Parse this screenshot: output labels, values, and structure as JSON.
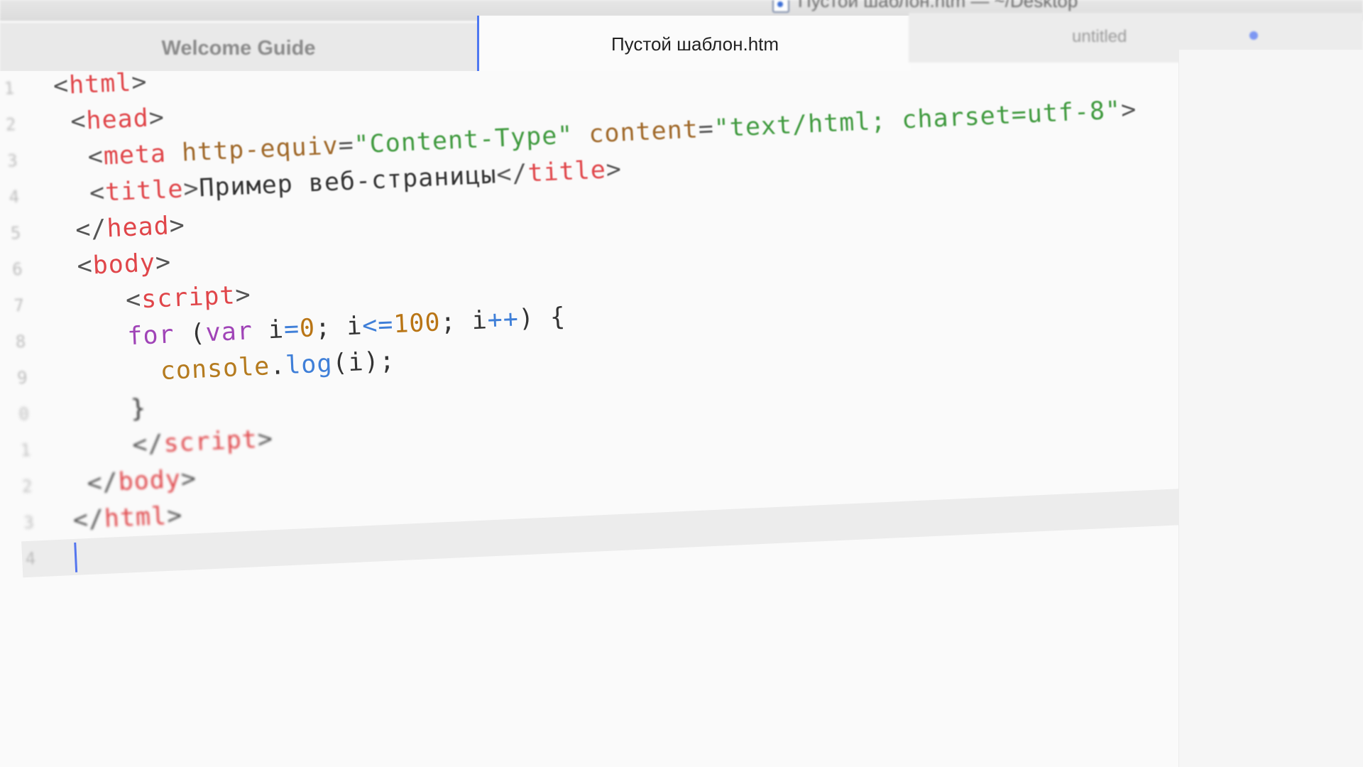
{
  "window": {
    "title": "Пустой шаблон.htm — ~/Desktop",
    "title_visible": "Пустой шаблон.htm — ~/Desktop"
  },
  "tabs": [
    {
      "label": "Welcome Guide",
      "active": false
    },
    {
      "label": "Пустой шаблон.htm",
      "active": true
    },
    {
      "label": "untitled",
      "active": false,
      "modified": true
    }
  ],
  "editor": {
    "line_numbers": [
      "1",
      "2",
      "3",
      "4",
      "5",
      "6",
      "7",
      "8",
      "9",
      "0",
      "1",
      "2",
      "3",
      "4"
    ],
    "cursor_line": 14,
    "lines": [
      [
        {
          "t": "<",
          "c": "pun"
        },
        {
          "t": "html",
          "c": "tag"
        },
        {
          "t": ">",
          "c": "pun"
        }
      ],
      [
        {
          "t": " <",
          "c": "pun"
        },
        {
          "t": "head",
          "c": "tag"
        },
        {
          "t": ">",
          "c": "pun"
        }
      ],
      [
        {
          "t": "  <",
          "c": "pun"
        },
        {
          "t": "meta",
          "c": "tag"
        },
        {
          "t": " http-equiv",
          "c": "attr"
        },
        {
          "t": "=",
          "c": "pun"
        },
        {
          "t": "\"Content-Type\"",
          "c": "str"
        },
        {
          "t": " content",
          "c": "attr"
        },
        {
          "t": "=",
          "c": "pun"
        },
        {
          "t": "\"text/html; charset=utf-8\"",
          "c": "str"
        },
        {
          "t": ">",
          "c": "pun"
        }
      ],
      [
        {
          "t": "  <",
          "c": "pun"
        },
        {
          "t": "title",
          "c": "tag"
        },
        {
          "t": ">",
          "c": "pun"
        },
        {
          "t": "Пример веб-страницы",
          "c": "plain"
        },
        {
          "t": "</",
          "c": "pun"
        },
        {
          "t": "title",
          "c": "tag"
        },
        {
          "t": ">",
          "c": "pun"
        }
      ],
      [
        {
          "t": " </",
          "c": "pun"
        },
        {
          "t": "head",
          "c": "tag"
        },
        {
          "t": ">",
          "c": "pun"
        }
      ],
      [
        {
          "t": " <",
          "c": "pun"
        },
        {
          "t": "body",
          "c": "tag"
        },
        {
          "t": ">",
          "c": "pun"
        }
      ],
      [
        {
          "t": "    <",
          "c": "pun"
        },
        {
          "t": "script",
          "c": "tag"
        },
        {
          "t": ">",
          "c": "pun"
        }
      ],
      [
        {
          "t": "    for",
          "c": "kw"
        },
        {
          "t": " (",
          "c": "plain"
        },
        {
          "t": "var",
          "c": "kw"
        },
        {
          "t": " i",
          "c": "plain"
        },
        {
          "t": "=",
          "c": "fn"
        },
        {
          "t": "0",
          "c": "num"
        },
        {
          "t": "; i",
          "c": "plain"
        },
        {
          "t": "<=",
          "c": "fn"
        },
        {
          "t": "100",
          "c": "num"
        },
        {
          "t": "; i",
          "c": "plain"
        },
        {
          "t": "++",
          "c": "fn"
        },
        {
          "t": ") {",
          "c": "plain"
        }
      ],
      [
        {
          "t": "      console",
          "c": "obj"
        },
        {
          "t": ".",
          "c": "plain"
        },
        {
          "t": "log",
          "c": "fn"
        },
        {
          "t": "(i);",
          "c": "plain"
        }
      ],
      [
        {
          "t": "    }",
          "c": "plain"
        }
      ],
      [
        {
          "t": "    </",
          "c": "pun"
        },
        {
          "t": "script",
          "c": "tag"
        },
        {
          "t": ">",
          "c": "pun"
        }
      ],
      [
        {
          "t": " </",
          "c": "pun"
        },
        {
          "t": "body",
          "c": "tag"
        },
        {
          "t": ">",
          "c": "pun"
        }
      ],
      [
        {
          "t": "</",
          "c": "pun"
        },
        {
          "t": "html",
          "c": "tag"
        },
        {
          "t": ">",
          "c": "pun"
        }
      ],
      []
    ]
  },
  "colors": {
    "tag": "#e0464a",
    "attribute": "#a0692a",
    "string": "#409a3f",
    "keyword": "#a044b7",
    "number": "#b97515",
    "function": "#3f7fd8",
    "accent": "#4f78f1"
  },
  "icons": {
    "title_doc": "document-icon",
    "modified": "modified-dot-icon"
  }
}
